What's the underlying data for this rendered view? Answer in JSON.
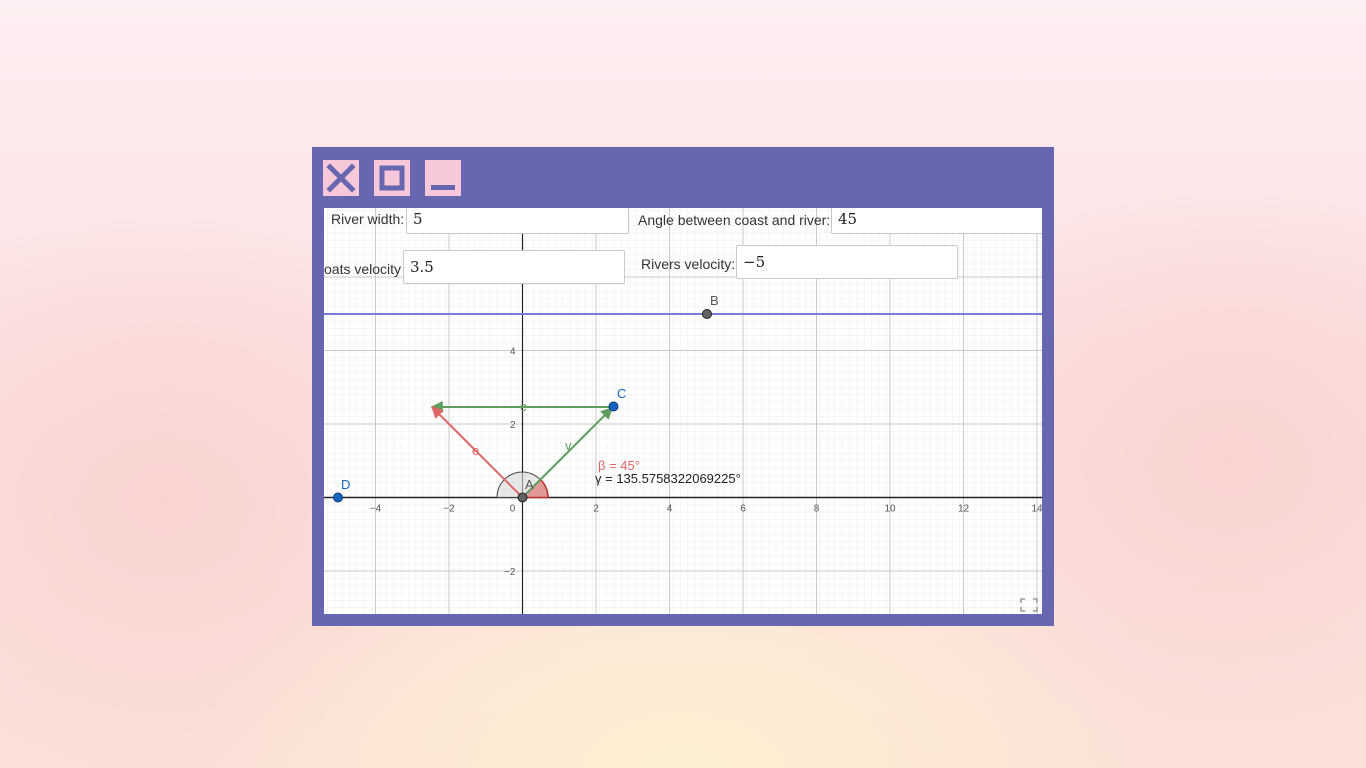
{
  "window_controls": {
    "close_icon": "close-icon",
    "maximize_icon": "maximize-icon",
    "minimize_icon": "minimize-icon"
  },
  "inputs": {
    "river_width": {
      "label": "River width:",
      "value": "5"
    },
    "angle": {
      "label": "Angle between coast and river:",
      "value": "45"
    },
    "boat_velocity": {
      "label": "oats velocity",
      "value": "3.5"
    },
    "river_velocity": {
      "label": "Rivers velocity:",
      "value": "−5"
    }
  },
  "graph": {
    "x_ticks": [
      "−4",
      "−2",
      "0",
      "2",
      "4",
      "6",
      "8",
      "10",
      "12",
      "14"
    ],
    "y_ticks": [
      "4",
      "2",
      "−2"
    ],
    "points": {
      "A": {
        "label": "A",
        "x": 0,
        "y": 0
      },
      "B": {
        "label": "B",
        "x": 5,
        "y": 5
      },
      "C": {
        "label": "C",
        "x": 2.47,
        "y": 2.47
      },
      "D": {
        "label": "D",
        "x": -5,
        "y": 0
      }
    },
    "vectors": {
      "v": "v",
      "c": "c",
      "e": "e"
    },
    "angle_beta": "β = 45°",
    "angle_gamma": "γ = 135.5758322069225°",
    "colors": {
      "line": "#6b6bd6",
      "green": "#5f9e5f",
      "red": "#e06666",
      "point_blue": "#1565c0",
      "point_gray": "#616161"
    }
  }
}
